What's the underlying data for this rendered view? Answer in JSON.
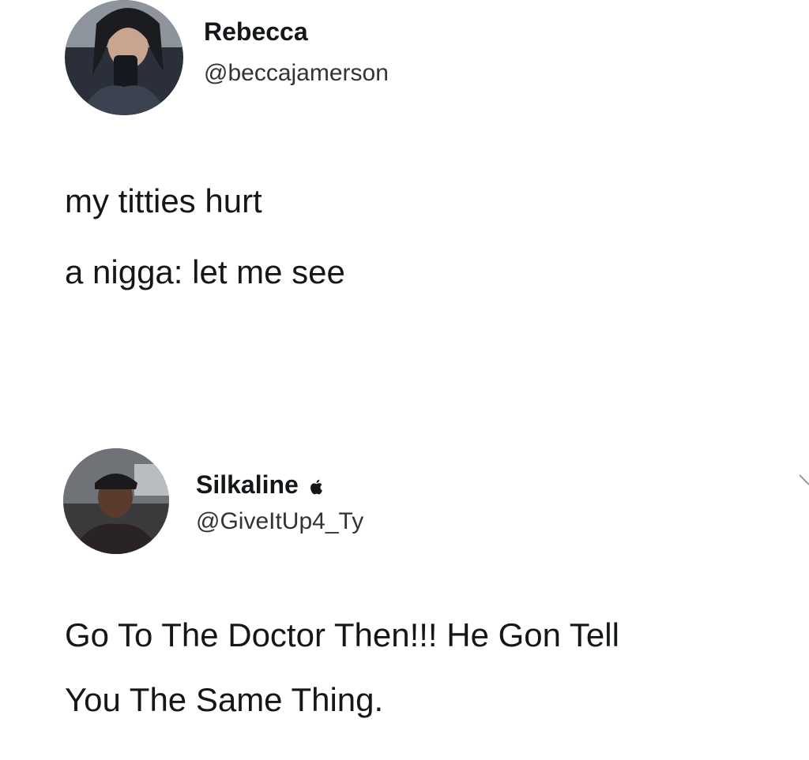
{
  "tweets": [
    {
      "display_name": "Rebecca",
      "handle": "@beccajamerson",
      "avatar_icon": "user-avatar-photo",
      "lines": [
        "my titties hurt",
        "a nigga: let me see"
      ]
    },
    {
      "display_name": "Silkaline",
      "handle": "@GiveItUp4_Ty",
      "badge_icon": "apple-icon",
      "avatar_icon": "user-avatar-photo",
      "lines": [
        "Go To The Doctor Then!!! He Gon Tell",
        "You The Same Thing."
      ]
    }
  ],
  "colors": {
    "background": "#ffffff",
    "text": "#14171a",
    "handle": "#333333"
  }
}
